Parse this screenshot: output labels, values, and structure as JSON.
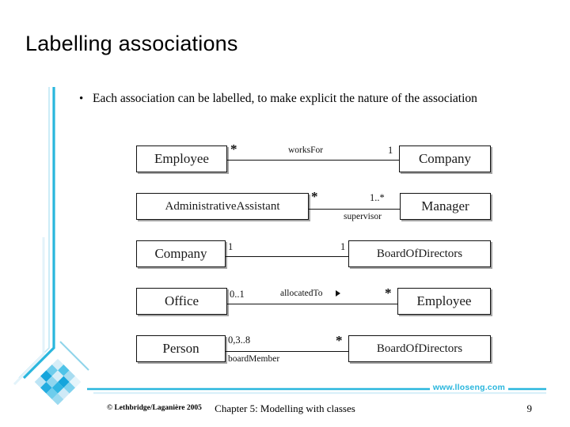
{
  "slide": {
    "title": "Labelling associations",
    "bullet": {
      "marker": "•",
      "text": "Each association can be labelled, to make explicit the nature of the association"
    }
  },
  "colors": {
    "accent_cyan": "#29b6dd",
    "accent_cyan_light": "#9fd9ee",
    "accent_blue": "#1a9fd4",
    "line_black": "#111111"
  },
  "diagram": {
    "rows": [
      {
        "left_class": "Employee",
        "right_class": "Company",
        "left_mult": "*",
        "right_mult": "1",
        "label": "worksFor",
        "role": "",
        "arrow": false
      },
      {
        "left_class": "AdministrativeAssistant",
        "right_class": "Manager",
        "left_mult": "*",
        "right_mult": "1..*",
        "label": "",
        "role": "supervisor",
        "arrow": false
      },
      {
        "left_class": "Company",
        "right_class": "BoardOfDirectors",
        "left_mult": "1",
        "right_mult": "1",
        "label": "",
        "role": "",
        "arrow": false
      },
      {
        "left_class": "Office",
        "right_class": "Employee",
        "left_mult": "0..1",
        "right_mult": "*",
        "label": "allocatedTo",
        "role": "",
        "arrow": true
      },
      {
        "left_class": "Person",
        "right_class": "BoardOfDirectors",
        "left_mult": "0,3..8",
        "right_mult": "*",
        "label": "",
        "role": "boardMember",
        "arrow": false
      }
    ]
  },
  "footer": {
    "url": "www.lloseng.com",
    "copyright": "© Lethbridge/Laganière 2005",
    "chapter": "Chapter 5: Modelling with classes",
    "page": "9"
  }
}
